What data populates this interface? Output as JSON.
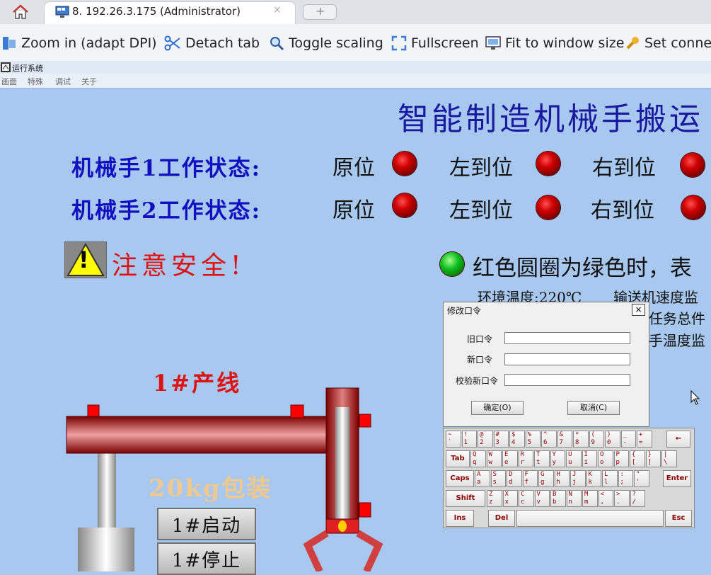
{
  "tabbar": {
    "tab_title": "8. 192.26.3.175 (Administrator)",
    "tab_close": "×",
    "new_tab": "+"
  },
  "toolbar": {
    "zoom_in": "Zoom in (adapt DPI)",
    "detach_tab": "Detach tab",
    "toggle_scaling": "Toggle scaling",
    "fullscreen": "Fullscreen",
    "fit_window": "Fit to window size",
    "set_connect": "Set connec"
  },
  "hmi": {
    "window_title": "运行系统",
    "menu": [
      "画面",
      "特殊",
      "调试",
      "关于"
    ],
    "title": "智能制造机械手搬运",
    "robot1_label": "机械手1工作状态:",
    "robot2_label": "机械手2工作状态:",
    "status": [
      "原位",
      "左到位",
      "右到位"
    ],
    "warning": "注意安全!",
    "warning_icon_char": "!",
    "legend": "红色圆圈为绿色时，表",
    "monitor": {
      "env_temp": "环境温度:220℃",
      "conveyor": "输送机速度监",
      "task": "任务总件",
      "hand_temp": "手温度监"
    },
    "line_label": "1#产线",
    "pkg_label": "20kg包装",
    "start_btn": "1#启动",
    "stop_btn": "1#停止",
    "colors": {
      "lamp_red": "#d00000",
      "lamp_green": "#10c020",
      "title_blue": "#1a1aa0",
      "alert_red": "#e01010"
    }
  },
  "dialog": {
    "title": "修改口令",
    "close": "×",
    "old_label": "旧口令",
    "new_label": "新口令",
    "verify_label": "校验新口令",
    "ok": "确定(O)",
    "cancel": "取消(C)"
  },
  "keyboard": {
    "row1": [
      "~\n`",
      "!\n1",
      "@\n2",
      "#\n3",
      "$\n4",
      "%\n5",
      "^\n6",
      "&\n7",
      "*\n8",
      "(\n9",
      ")\n0",
      "_\n-",
      "+\n="
    ],
    "row2": [
      "Q\nq",
      "W\nw",
      "E\ne",
      "R\nr",
      "T\nt",
      "Y\ny",
      "U\nu",
      "I\ni",
      "O\no",
      "P\np",
      "{\n[",
      "}\n]",
      "|\n\\"
    ],
    "row3": [
      "A\na",
      "S\ns",
      "D\nd",
      "F\nf",
      "G\ng",
      "H\nh",
      "J\nj",
      "K\nk",
      "L\nl",
      ":\n;",
      "\"\n'"
    ],
    "row4": [
      "Z\nz",
      "X\nx",
      "C\nc",
      "V\nv",
      "B\nb",
      "N\nn",
      "M\nm",
      "<\n,",
      ">\n.",
      "?\n/"
    ],
    "backspace": "←",
    "tab": "Tab",
    "caps": "Caps",
    "enter": "Enter",
    "shift": "Shift",
    "ins": "Ins",
    "del": "Del",
    "esc": "Esc"
  }
}
